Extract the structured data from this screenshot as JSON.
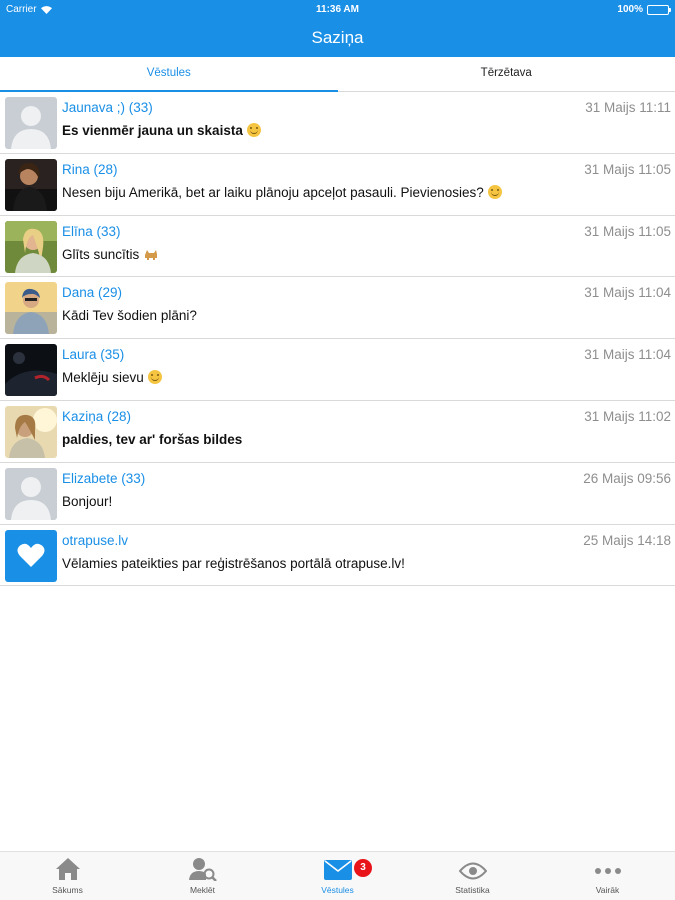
{
  "status_bar": {
    "carrier": "Carrier",
    "time": "11:36 AM",
    "battery": "100%"
  },
  "header": {
    "title": "Saziņa"
  },
  "tabs": [
    {
      "label": "Vēstules",
      "active": true
    },
    {
      "label": "Tērzētava",
      "active": false
    }
  ],
  "conversations": [
    {
      "name": "Jaunava ;) (33)",
      "date": "31 Maijs 11:11",
      "message": "Es vienmēr jauna un skaista",
      "unread": true,
      "avatar": "placeholder-avatar-icon"
    },
    {
      "name": "Rina (28)",
      "date": "31 Maijs 11:05",
      "message": "Nesen biju Amerikā, bet ar laiku plānoju apceļot pasauli. Pievienosies?",
      "unread": false,
      "avatar": "user-photo"
    },
    {
      "name": "Elīna (33)",
      "date": "31 Maijs 11:05",
      "message": "Glīts suncītis",
      "unread": false,
      "avatar": "user-photo"
    },
    {
      "name": "Dana (29)",
      "date": "31 Maijs 11:04",
      "message": "Kādi Tev šodien plāni?",
      "unread": false,
      "avatar": "user-photo"
    },
    {
      "name": "Laura (35)",
      "date": "31 Maijs 11:04",
      "message": "Meklēju sievu",
      "unread": false,
      "avatar": "user-photo"
    },
    {
      "name": "Kaziņa (28)",
      "date": "31 Maijs 11:02",
      "message": "paldies, tev ar' foršas bildes",
      "unread": true,
      "avatar": "user-photo"
    },
    {
      "name": "Elizabete (33)",
      "date": "26 Maijs 09:56",
      "message": "Bonjour!",
      "unread": false,
      "avatar": "placeholder-avatar-icon"
    },
    {
      "name": "otrapuse.lv",
      "date": "25 Maijs 14:18",
      "message": "Vēlamies pateikties par reģistrēšanos portālā otrapuse.lv!",
      "unread": false,
      "avatar": "heart-icon"
    }
  ],
  "tabbar": {
    "items": [
      {
        "label": "Sākums",
        "icon": "home-icon"
      },
      {
        "label": "Meklēt",
        "icon": "search-person-icon"
      },
      {
        "label": "Vēstules",
        "icon": "mail-icon",
        "active": true,
        "badge": "3"
      },
      {
        "label": "Statistika",
        "icon": "eye-icon"
      },
      {
        "label": "Vairāk",
        "icon": "more-dots-icon"
      }
    ]
  },
  "colors": {
    "accent": "#1a8fe6",
    "badge": "#e8141a",
    "divider": "#d9d9d9"
  }
}
